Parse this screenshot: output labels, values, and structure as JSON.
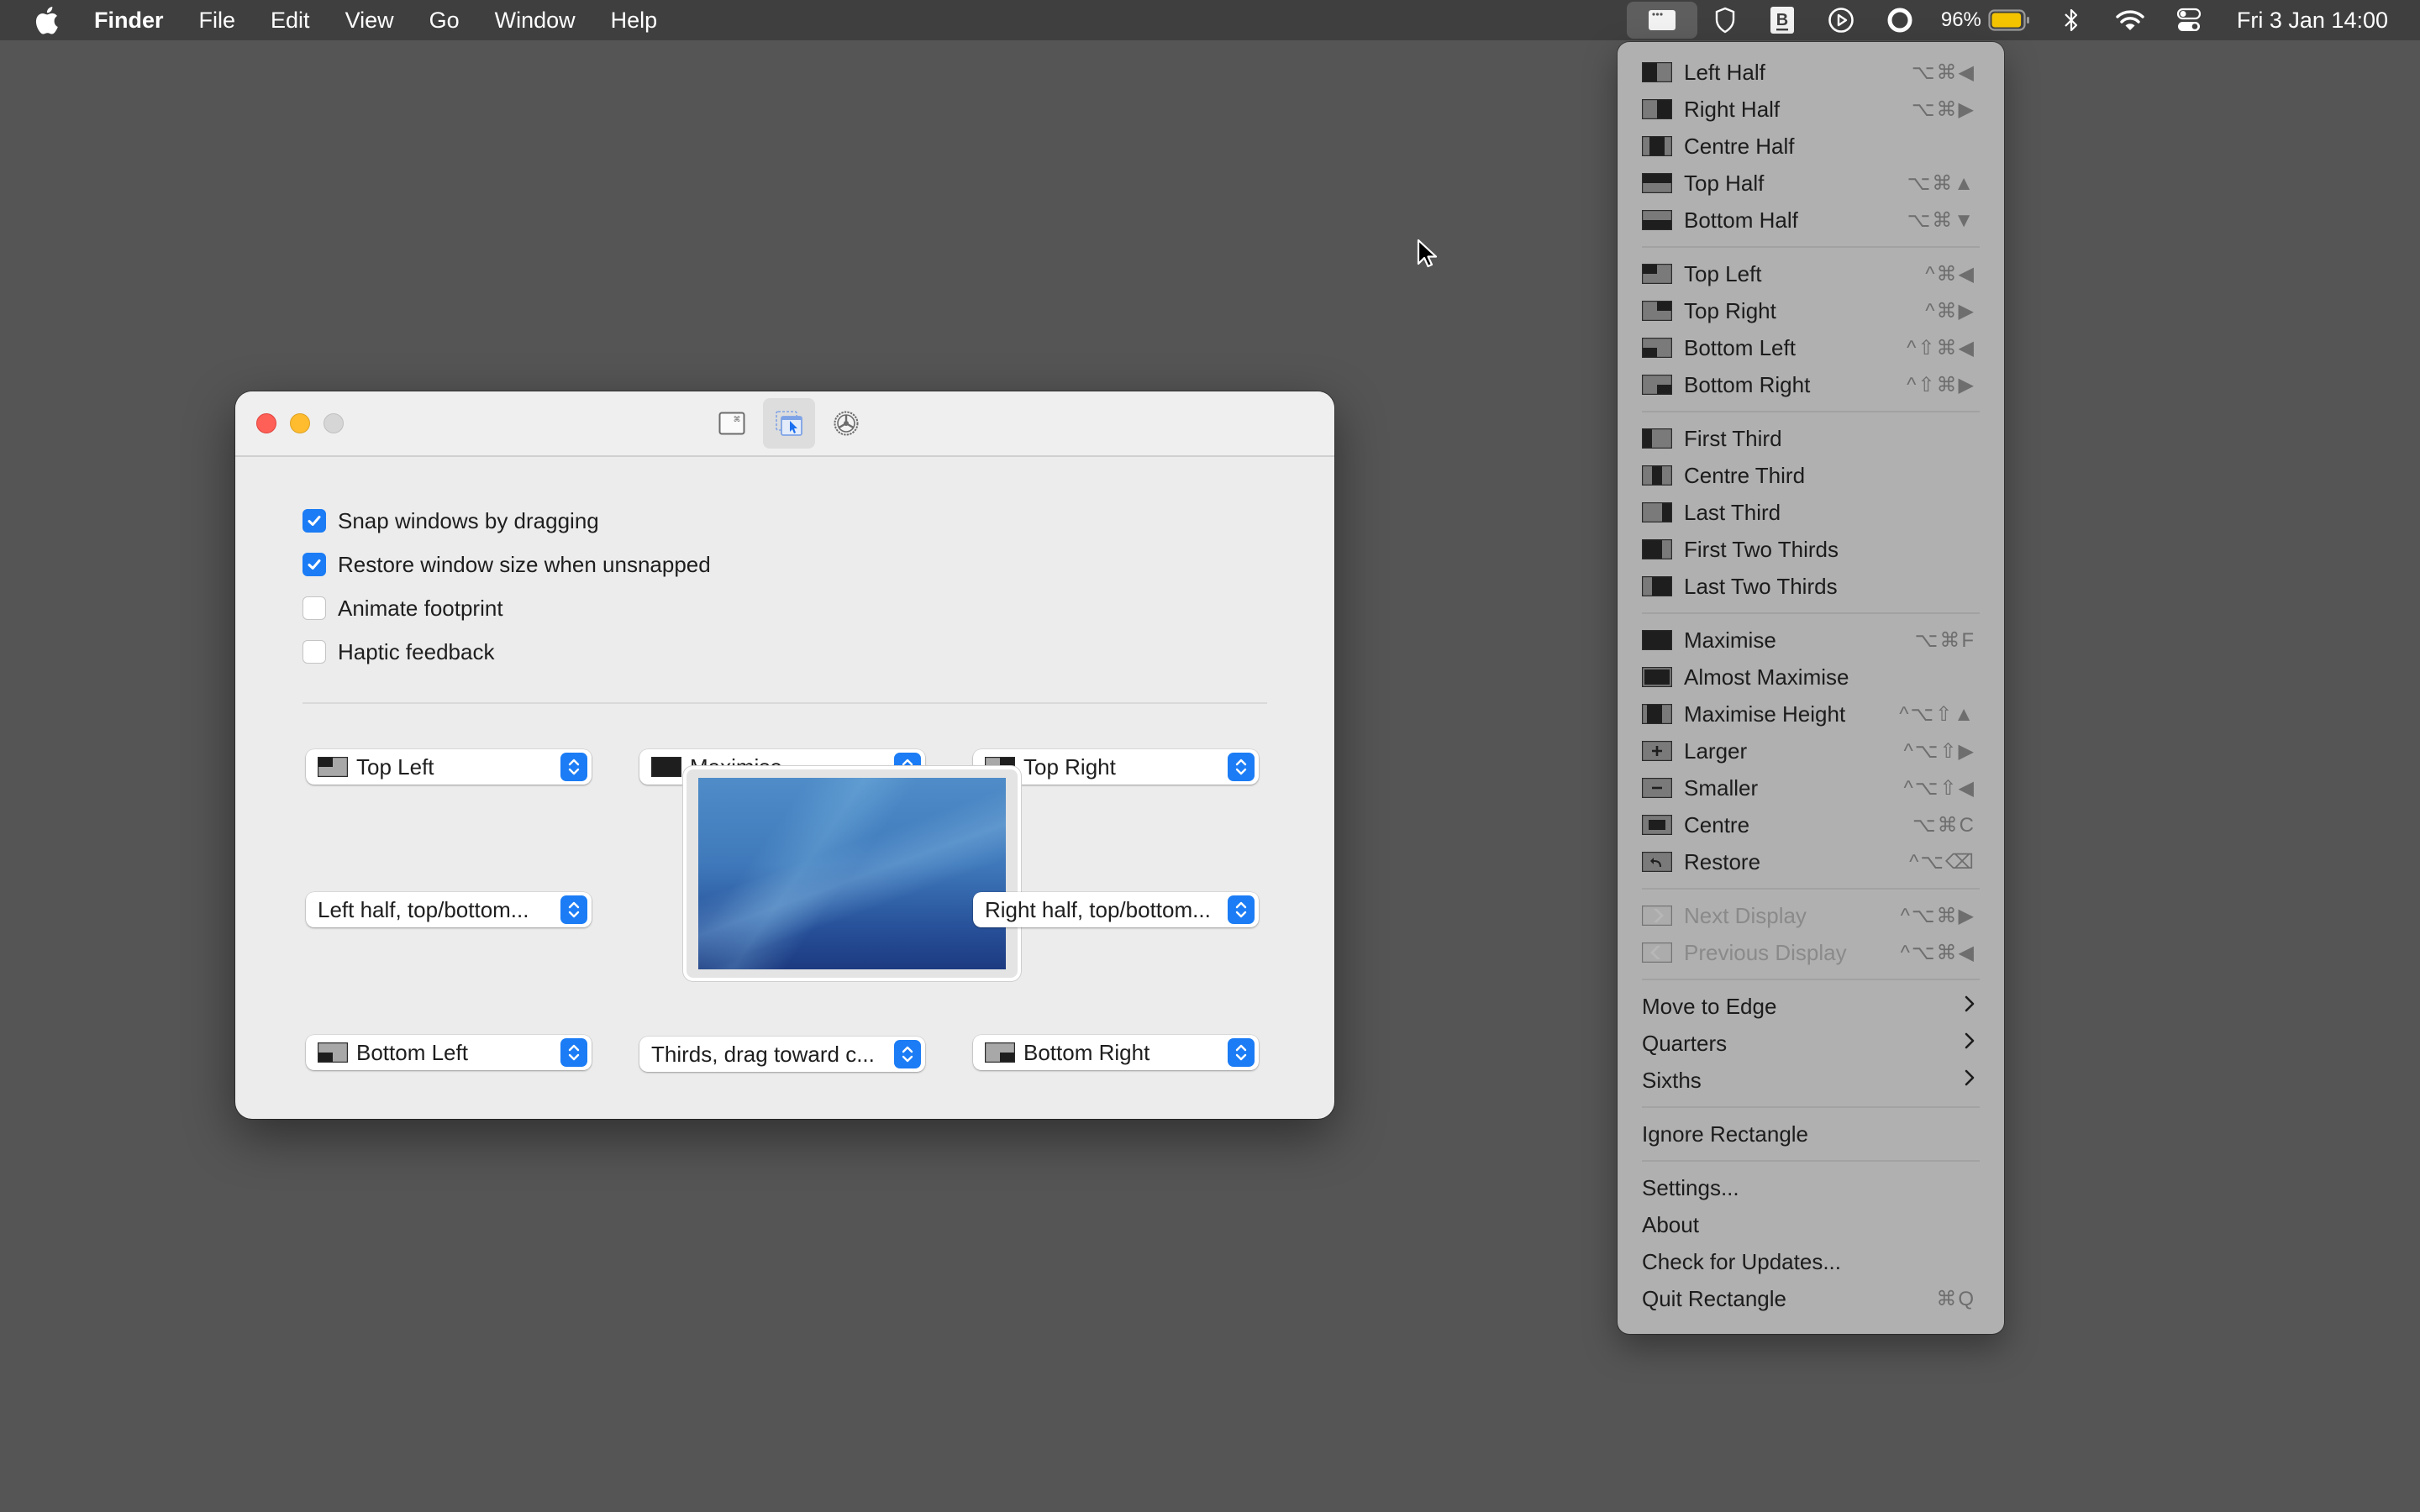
{
  "menubar": {
    "app_name": "Finder",
    "menus": [
      "File",
      "Edit",
      "View",
      "Go",
      "Window",
      "Help"
    ],
    "status_icons": [
      "rectangle-app-icon",
      "shield-icon",
      "bold-b-icon",
      "play-circle-icon",
      "ring-icon"
    ],
    "battery_percent": "96%",
    "battery_level": 0.96,
    "battery_color": "#f5c400",
    "clock": "Fri 3 Jan  14:00"
  },
  "window": {
    "toolbar_tabs": [
      {
        "name": "keyboard-shortcuts-tab",
        "selected": false
      },
      {
        "name": "snap-areas-tab",
        "selected": true
      },
      {
        "name": "general-settings-tab",
        "selected": false
      }
    ],
    "checkboxes": [
      {
        "label": "Snap windows by dragging",
        "checked": true
      },
      {
        "label": "Restore window size when unsnapped",
        "checked": true
      },
      {
        "label": "Animate footprint",
        "checked": false
      },
      {
        "label": "Haptic feedback",
        "checked": false
      }
    ],
    "snap_popups": {
      "top_left": {
        "label": "Top Left",
        "icon": "top-left"
      },
      "top": {
        "label": "Maximise",
        "icon": "maximise"
      },
      "top_right": {
        "label": "Top Right",
        "icon": "top-right"
      },
      "left": {
        "label": "Left half, top/bottom..."
      },
      "right": {
        "label": "Right half, top/bottom..."
      },
      "bottom_left": {
        "label": "Bottom Left",
        "icon": "bottom-left"
      },
      "bottom": {
        "label": "Thirds, drag toward c..."
      },
      "bottom_right": {
        "label": "Bottom Right",
        "icon": "bottom-right"
      }
    },
    "accent_color": "#1b7cf5"
  },
  "menu": {
    "groups": [
      [
        {
          "label": "Left Half",
          "icon": "left-half",
          "shortcut": "⌥⌘◀"
        },
        {
          "label": "Right Half",
          "icon": "right-half",
          "shortcut": "⌥⌘▶"
        },
        {
          "label": "Centre Half",
          "icon": "centre-half",
          "shortcut": ""
        },
        {
          "label": "Top Half",
          "icon": "top-half",
          "shortcut": "⌥⌘▲"
        },
        {
          "label": "Bottom Half",
          "icon": "bottom-half",
          "shortcut": "⌥⌘▼"
        }
      ],
      [
        {
          "label": "Top Left",
          "icon": "top-left",
          "shortcut": "^⌘◀"
        },
        {
          "label": "Top Right",
          "icon": "top-right",
          "shortcut": "^⌘▶"
        },
        {
          "label": "Bottom Left",
          "icon": "bottom-left",
          "shortcut": "^⇧⌘◀"
        },
        {
          "label": "Bottom Right",
          "icon": "bottom-right",
          "shortcut": "^⇧⌘▶"
        }
      ],
      [
        {
          "label": "First Third",
          "icon": "first-third",
          "shortcut": ""
        },
        {
          "label": "Centre Third",
          "icon": "centre-third",
          "shortcut": ""
        },
        {
          "label": "Last Third",
          "icon": "last-third",
          "shortcut": ""
        },
        {
          "label": "First Two Thirds",
          "icon": "first-two-thirds",
          "shortcut": ""
        },
        {
          "label": "Last Two Thirds",
          "icon": "last-two-thirds",
          "shortcut": ""
        }
      ],
      [
        {
          "label": "Maximise",
          "icon": "maximise",
          "shortcut": "⌥⌘F"
        },
        {
          "label": "Almost Maximise",
          "icon": "almost-maximise",
          "shortcut": ""
        },
        {
          "label": "Maximise Height",
          "icon": "maximise-height",
          "shortcut": "^⌥⇧▲"
        },
        {
          "label": "Larger",
          "icon": "larger",
          "shortcut": "^⌥⇧▶"
        },
        {
          "label": "Smaller",
          "icon": "smaller",
          "shortcut": "^⌥⇧◀"
        },
        {
          "label": "Centre",
          "icon": "centre",
          "shortcut": "⌥⌘C"
        },
        {
          "label": "Restore",
          "icon": "restore",
          "shortcut": "^⌥⌫"
        }
      ],
      [
        {
          "label": "Next Display",
          "icon": "next-display",
          "shortcut": "^⌥⌘▶",
          "disabled": true
        },
        {
          "label": "Previous Display",
          "icon": "previous-display",
          "shortcut": "^⌥⌘◀",
          "disabled": true
        }
      ],
      [
        {
          "label": "Move to Edge",
          "submenu": true
        },
        {
          "label": "Quarters",
          "submenu": true
        },
        {
          "label": "Sixths",
          "submenu": true
        }
      ],
      [
        {
          "label": "Ignore Rectangle"
        }
      ],
      [
        {
          "label": "Settings..."
        },
        {
          "label": "About"
        },
        {
          "label": "Check for Updates..."
        },
        {
          "label": "Quit Rectangle",
          "shortcut": "⌘Q"
        }
      ]
    ]
  }
}
